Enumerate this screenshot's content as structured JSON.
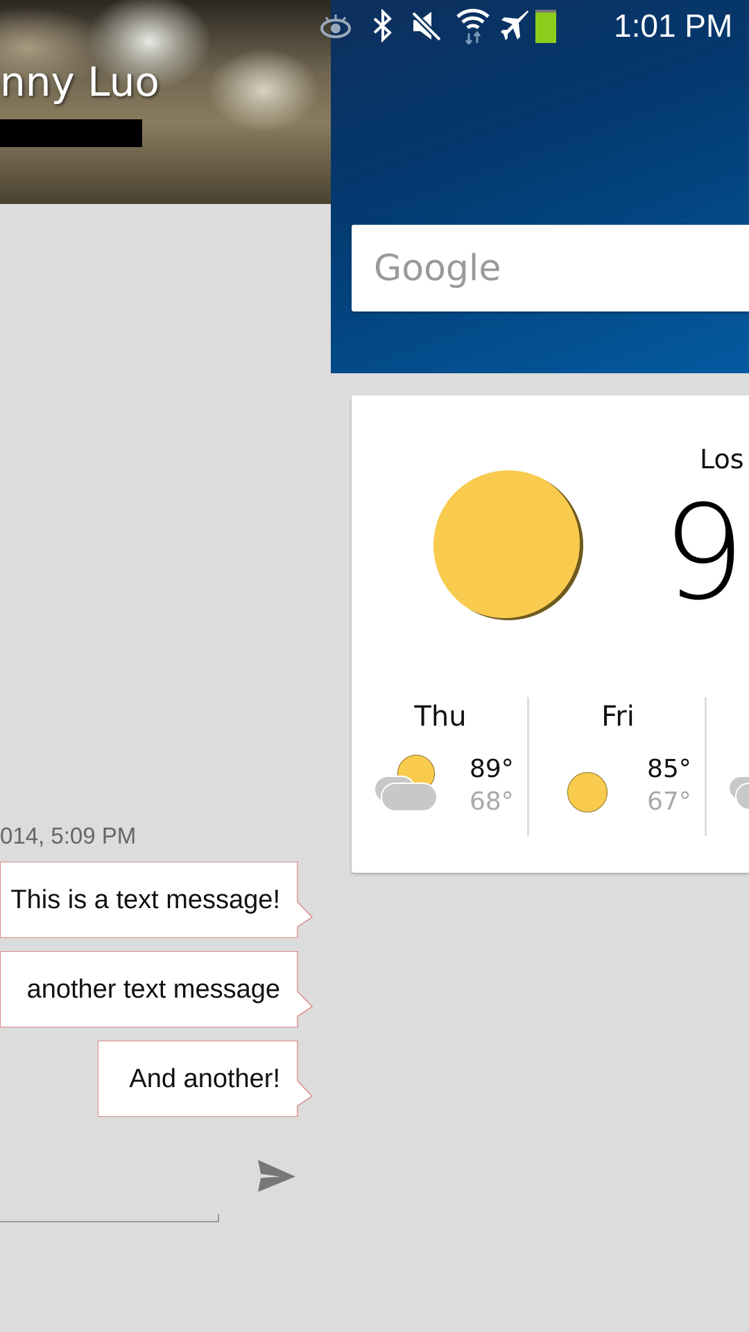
{
  "status_bar": {
    "time": "1:01 PM",
    "icons": [
      "eye-icon",
      "bluetooth-icon",
      "mute-icon",
      "wifi-icon",
      "airplane-icon",
      "battery-icon"
    ],
    "battery_color": "#8ccc1c"
  },
  "contact": {
    "name": "nny Luo"
  },
  "search": {
    "placeholder": "Google"
  },
  "weather": {
    "city": "Los",
    "current_temp": "9",
    "current_icon": "sun-icon",
    "forecast": [
      {
        "day": "Thu",
        "high": "89°",
        "low": "68°",
        "icon": "partly-cloudy-icon"
      },
      {
        "day": "Fri",
        "high": "85°",
        "low": "67°",
        "icon": "sun-icon"
      }
    ]
  },
  "conversation": {
    "timestamp": "014, 5:09 PM",
    "messages": [
      "This is a text message!",
      "another text message",
      "And another!"
    ],
    "bubble_border": "#dd8888"
  },
  "composer": {
    "send_icon": "send-icon"
  }
}
